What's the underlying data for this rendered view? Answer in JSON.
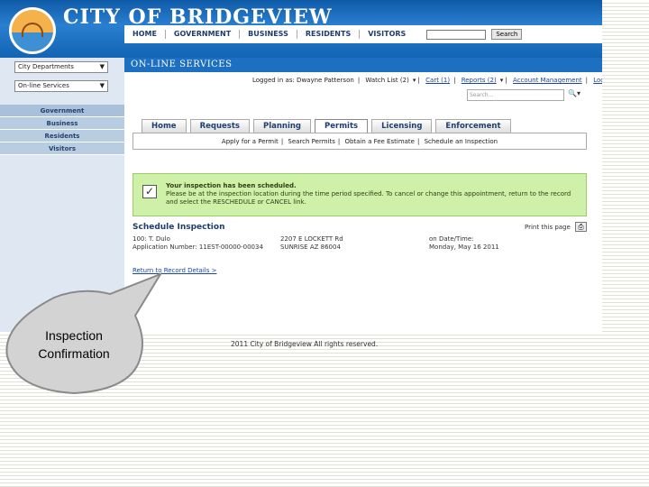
{
  "header": {
    "title": "CITY OF BRIDGEVIEW",
    "logo_text": "CITY OF BRIDGEVIEW",
    "nav": [
      "HOME",
      "GOVERNMENT",
      "BUSINESS",
      "RESIDENTS",
      "VISITORS"
    ],
    "search_button": "Search"
  },
  "sidebar": {
    "dropdown1": "City Departments",
    "dropdown2": "On-line Services",
    "menu": [
      "Government",
      "Business",
      "Residents",
      "Visitors"
    ]
  },
  "services": {
    "title": "ON-LINE SERVICES",
    "logged_in": "Logged in as: Dwayne Patterson",
    "watch_list": "Watch List (2)",
    "cart": "Cart (1)",
    "reports": "Reports (2)",
    "account": "Account Management",
    "logout": "Logout",
    "search_placeholder": "Search..."
  },
  "tabs": [
    "Home",
    "Requests",
    "Planning",
    "Permits",
    "Licensing",
    "Enforcement"
  ],
  "active_tab": "Permits",
  "subnav": [
    "Apply for a Permit",
    "Search Permits",
    "Obtain a Fee Estimate",
    "Schedule an Inspection"
  ],
  "notice": {
    "line1": "Your inspection has been scheduled.",
    "line2": "Please be at the inspection location during the time period specified. To cancel or change this appointment, return to the record and select the RESCHEDULE or CANCEL link."
  },
  "schedule": {
    "title": "Schedule Inspection",
    "print_label": "Print this page",
    "col1_line1": "100: T. Dulo",
    "col1_line2": "Application Number: 11EST-00000-00034",
    "col2_line1": "2207 E LOCKETT Rd",
    "col2_line2": "SUNRISE AZ 86004",
    "col3_line1": "on Date/Time:",
    "col3_line2": "Monday, May 16 2011",
    "return_link": "Return to Record Details >"
  },
  "footer": "2011 City of Bridgeview All rights reserved.",
  "callout": {
    "line1": "Inspection",
    "line2": "Confirmation"
  },
  "colors": {
    "banner": "#1264b4",
    "services_bar": "#1d6fc2",
    "notice_bg": "#cff0a8",
    "link": "#1a44aa"
  }
}
